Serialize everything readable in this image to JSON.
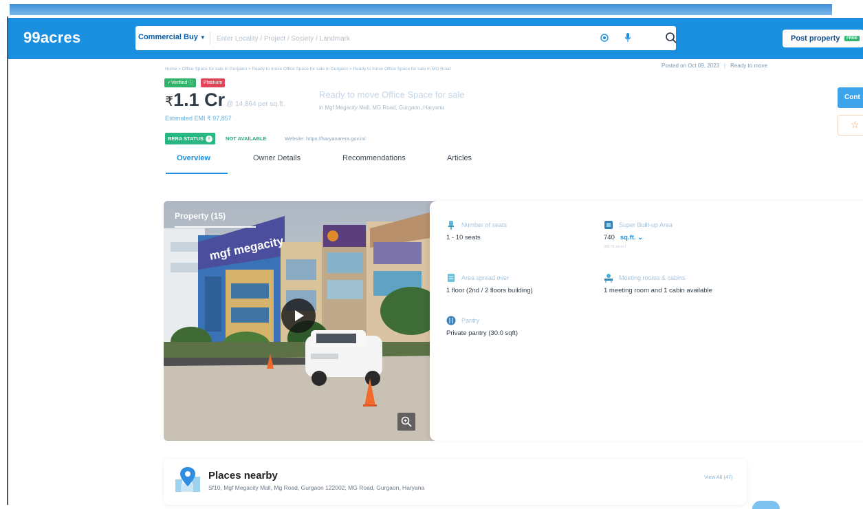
{
  "header": {
    "logo": "99acres",
    "search_type": "Commercial Buy",
    "search_placeholder": "Enter Locality / Project / Society / Landmark",
    "post_property_label": "Post property",
    "post_property_badge": "FREE",
    "icons": [
      "location-icon",
      "mic-icon",
      "search-icon",
      "chevron-down-icon"
    ]
  },
  "breadcrumb": "Home > Office Space for sale in Gurgaon > Ready to move Office Space for sale in Gurgaon > Ready to move Office Space for sale in MG Road",
  "posted": {
    "date": "Posted on Oct 09, 2023",
    "status": "Ready to move"
  },
  "badges": {
    "verified": "Verified",
    "platinum": "Platinum"
  },
  "listing": {
    "currency": "₹",
    "price": "1.1 Cr",
    "price_per_sqft": "@ 14,864 per sq.ft.",
    "title": "Ready to move Office Space for sale",
    "address": "in Mgf Megacity Mall, MG Road, Gurgaon, Haryana",
    "emi": "Estimated EMI ₹ 97,857"
  },
  "rera": {
    "label": "RERA STATUS",
    "status": "NOT AVAILABLE",
    "website": "Website: https://haryanarera.gov.in/"
  },
  "tabs": [
    "Overview",
    "Owner Details",
    "Recommendations",
    "Articles"
  ],
  "media": {
    "label": "Property (15)",
    "building_sign": "mgf megacity"
  },
  "details": {
    "seats": {
      "label": "Number of seats",
      "value": "1 - 10 seats"
    },
    "area": {
      "label": "Super Built-up Area",
      "value": "740",
      "unit": "sq.ft.",
      "sub": "(68.75 sq.m.)"
    },
    "floor": {
      "label": "Area spread over",
      "value": "1 floor (2nd / 2 floors building)"
    },
    "rooms": {
      "label": "Meeting rooms & cabins",
      "value": "1 meeting room and 1 cabin available"
    },
    "pantry": {
      "label": "Pantry",
      "value": "Private pantry (30.0 sqft)"
    }
  },
  "right_rail": {
    "contact_label": "Cont"
  },
  "places_nearby": {
    "title": "Places nearby",
    "address": "Sf10, Mgf Megacity Mall, Mg Road, Gurgaon 122002, MG Road, Gurgaon, Haryana",
    "view_all": "View All (47)"
  },
  "colors": {
    "brand_blue": "#1a8fe0",
    "rera_green": "#28b681",
    "platinum_red": "#e0455a",
    "star_orange": "#f3a35e"
  }
}
